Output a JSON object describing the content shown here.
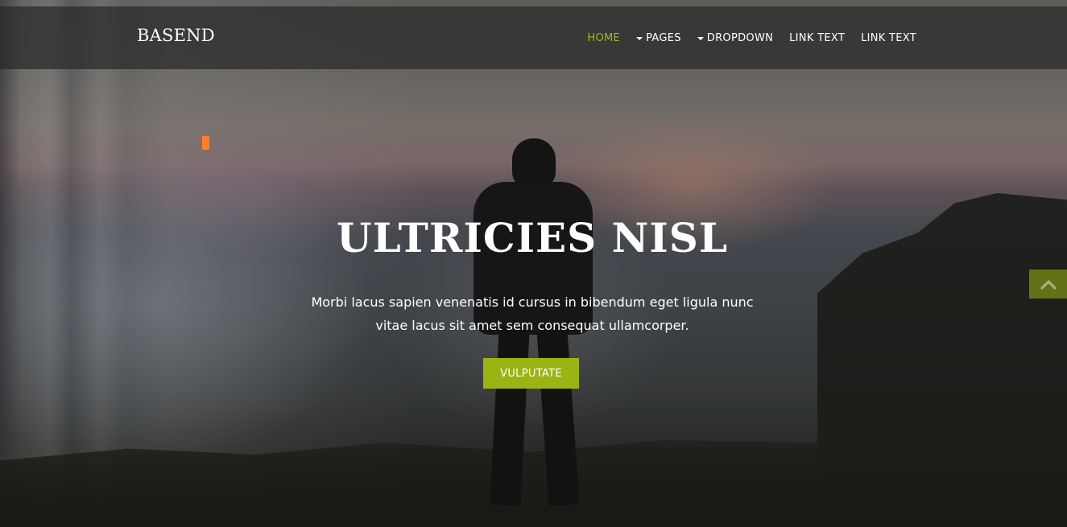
{
  "header": {
    "brand": "BASEND",
    "nav": [
      {
        "label": "HOME",
        "active": true,
        "dropdown": false
      },
      {
        "label": "PAGES",
        "active": false,
        "dropdown": true
      },
      {
        "label": "DROPDOWN",
        "active": false,
        "dropdown": true
      },
      {
        "label": "LINK TEXT",
        "active": false,
        "dropdown": false
      },
      {
        "label": "LINK TEXT",
        "active": false,
        "dropdown": false
      }
    ]
  },
  "hero": {
    "title": "ULTRICIES NISL",
    "text": "Morbi lacus sapien venenatis id cursus in bibendum eget ligula nunc vitae lacus sit amet sem consequat ullamcorper.",
    "button_label": "VULPUTATE"
  },
  "icons": {
    "caret": "caret-down-icon",
    "scroll_top": "chevron-up-icon"
  },
  "colors": {
    "accent": "#9cb314",
    "active_nav": "#9dbc1e",
    "scroll_top_bg": "#6b7a17"
  }
}
